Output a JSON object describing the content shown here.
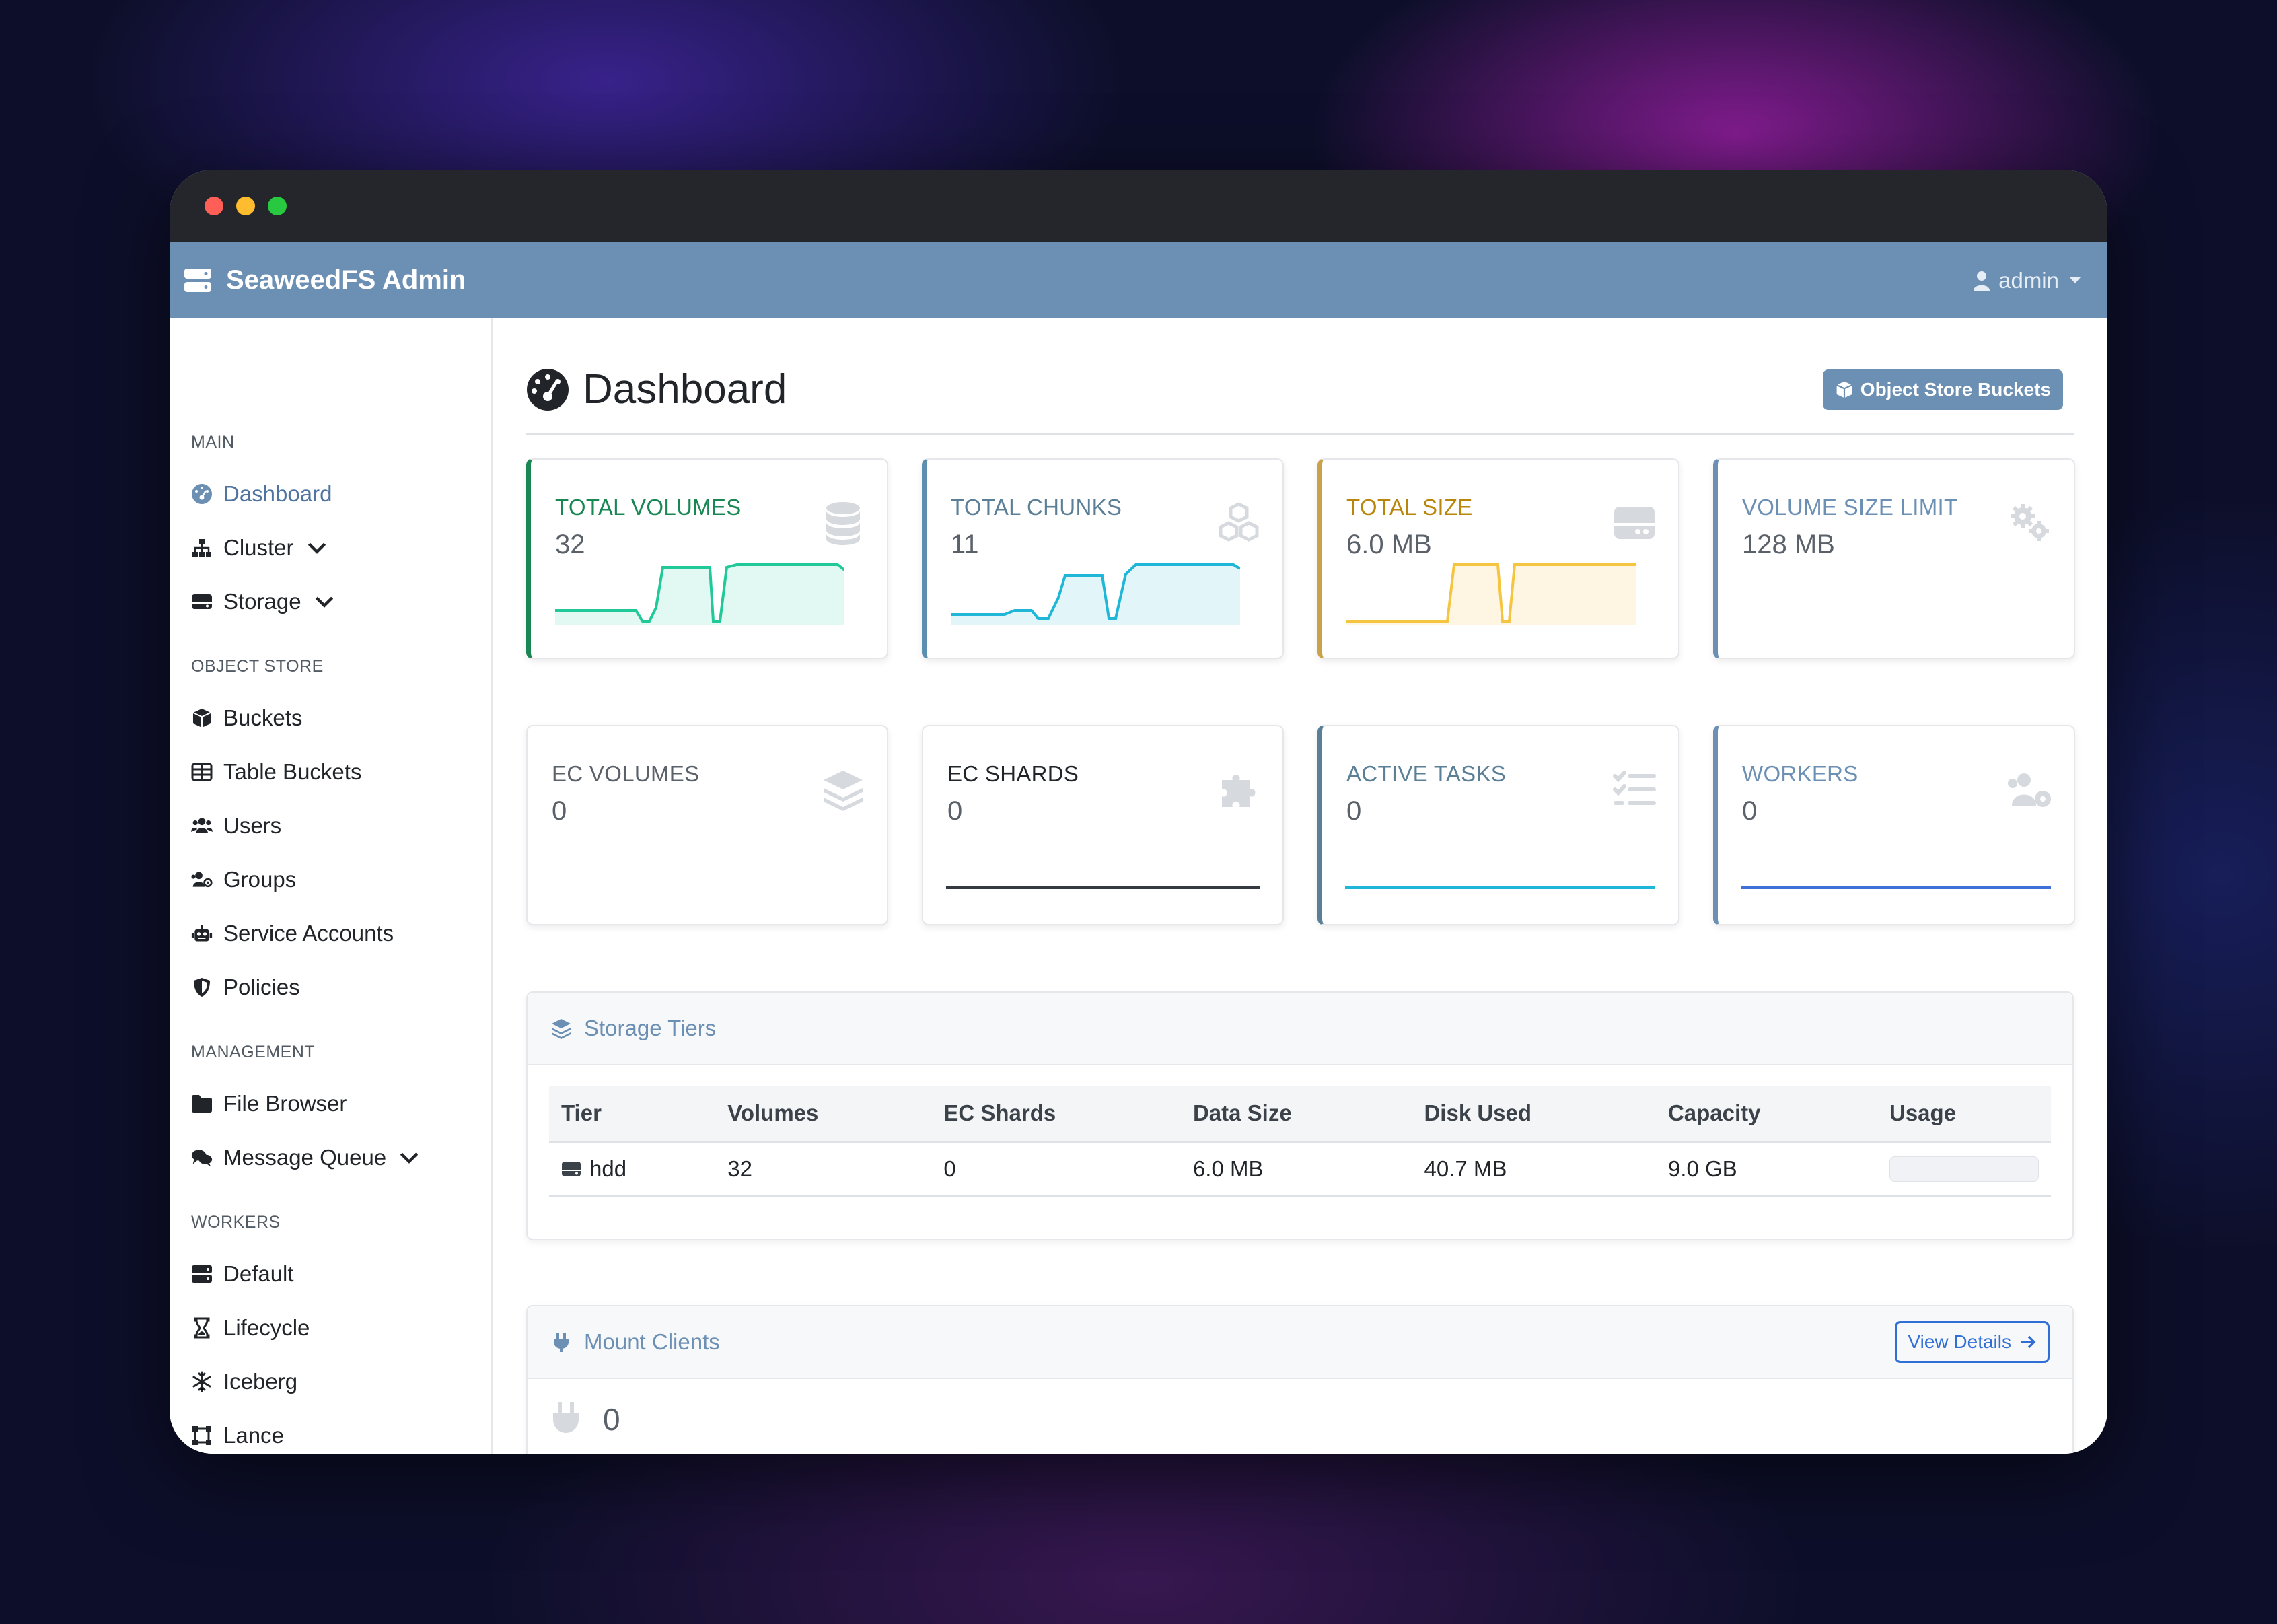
{
  "app": {
    "brand": "SeaweedFS Admin",
    "user": "admin"
  },
  "sidebar": {
    "sections": [
      {
        "label": "MAIN",
        "items": [
          {
            "label": "Dashboard",
            "icon": "dashboard-icon",
            "active": true
          },
          {
            "label": "Cluster",
            "icon": "sitemap-icon",
            "expandable": true
          },
          {
            "label": "Storage",
            "icon": "hdd-icon",
            "expandable": true
          }
        ]
      },
      {
        "label": "OBJECT STORE",
        "items": [
          {
            "label": "Buckets",
            "icon": "cube-icon"
          },
          {
            "label": "Table Buckets",
            "icon": "table-icon"
          },
          {
            "label": "Users",
            "icon": "users-icon"
          },
          {
            "label": "Groups",
            "icon": "users-gear-icon"
          },
          {
            "label": "Service Accounts",
            "icon": "robot-icon"
          },
          {
            "label": "Policies",
            "icon": "shield-icon"
          }
        ]
      },
      {
        "label": "MANAGEMENT",
        "items": [
          {
            "label": "File Browser",
            "icon": "folder-icon"
          },
          {
            "label": "Message Queue",
            "icon": "comments-icon",
            "expandable": true
          }
        ]
      },
      {
        "label": "WORKERS",
        "items": [
          {
            "label": "Default",
            "icon": "server-icon"
          },
          {
            "label": "Lifecycle",
            "icon": "hourglass-icon"
          },
          {
            "label": "Iceberg",
            "icon": "snowflake-icon"
          },
          {
            "label": "Lance",
            "icon": "vector-square-icon"
          }
        ]
      }
    ]
  },
  "page": {
    "title": "Dashboard",
    "action_button": "Object Store Buckets"
  },
  "cards": [
    {
      "label": "TOTAL VOLUMES",
      "value": "32",
      "color": "#198754",
      "accent": "#20c997",
      "icon": "database-icon"
    },
    {
      "label": "TOTAL CHUNKS",
      "value": "11",
      "color": "#0d8aa8",
      "accent": "#1fb6d8",
      "icon": "cubes-icon"
    },
    {
      "label": "TOTAL SIZE",
      "value": "6.0 MB",
      "color": "#b8860b",
      "accent": "#f5c542",
      "icon": "hdd-icon"
    },
    {
      "label": "VOLUME SIZE LIMIT",
      "value": "128 MB",
      "color": "#6c8fb4",
      "accent": "#6c8fb4",
      "icon": "cogs-icon"
    },
    {
      "label": "EC VOLUMES",
      "value": "0",
      "color": "#5a6169",
      "icon": "layer-group-icon"
    },
    {
      "label": "EC SHARDS",
      "value": "0",
      "color": "#212529",
      "icon": "puzzle-piece-icon"
    },
    {
      "label": "ACTIVE TASKS",
      "value": "0",
      "color": "#0d8aa8",
      "accent": "#1fb6d8",
      "icon": "tasks-icon"
    },
    {
      "label": "WORKERS",
      "value": "0",
      "color": "#6c8fb4",
      "accent": "#3f6fd8",
      "icon": "users-cog-icon"
    }
  ],
  "storage_tiers": {
    "title": "Storage Tiers",
    "columns": [
      "Tier",
      "Volumes",
      "EC Shards",
      "Data Size",
      "Disk Used",
      "Capacity",
      "Usage"
    ],
    "rows": [
      {
        "tier": "hdd",
        "volumes": "32",
        "ec_shards": "0",
        "data_size": "6.0 MB",
        "disk_used": "40.7 MB",
        "capacity": "9.0 GB",
        "usage_fraction": 0.0
      }
    ]
  },
  "mount_clients": {
    "title": "Mount Clients",
    "view_details": "View Details",
    "count": "0"
  }
}
